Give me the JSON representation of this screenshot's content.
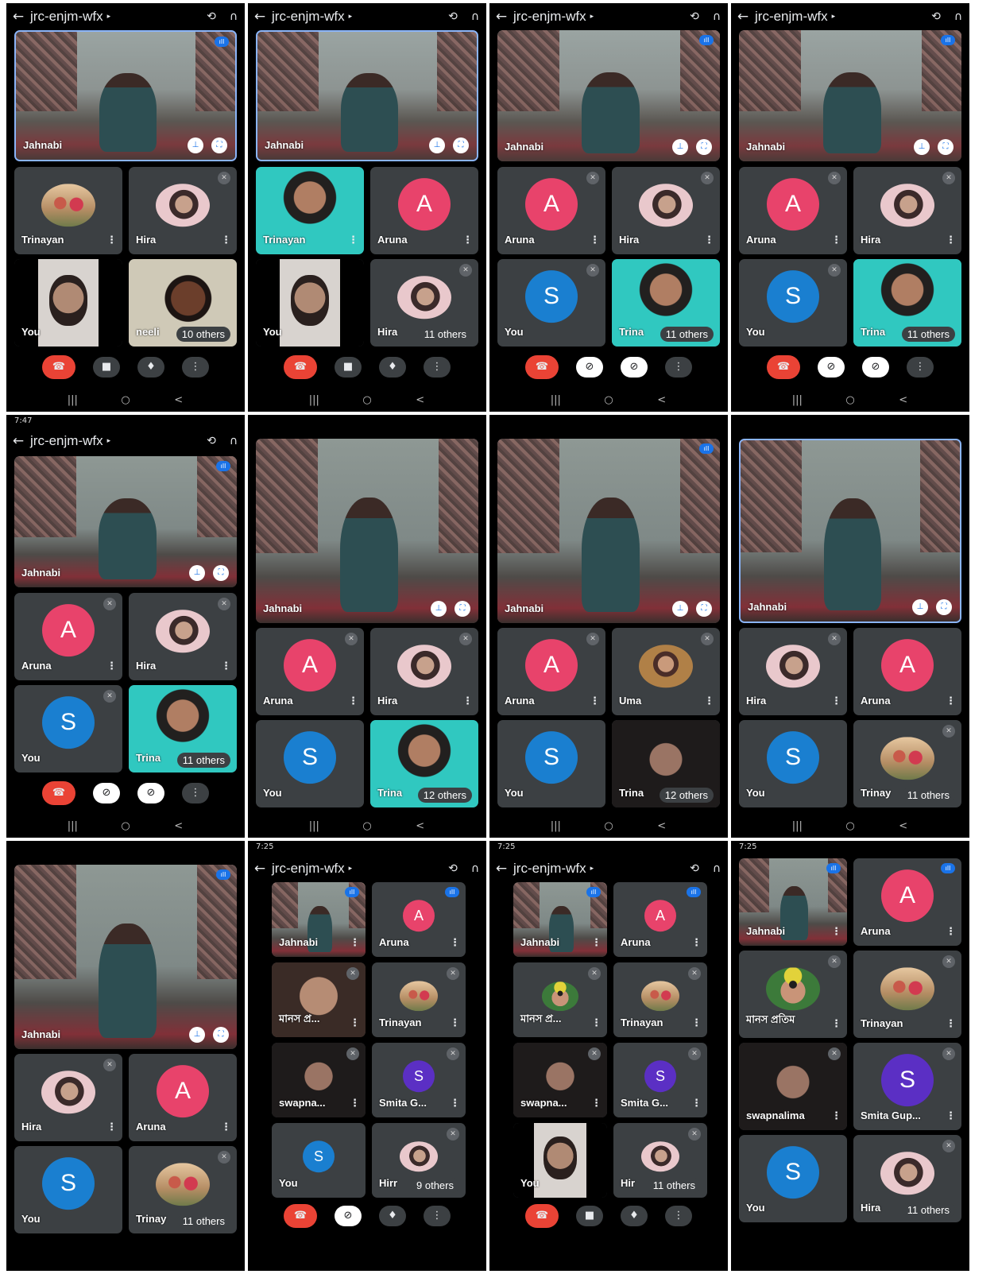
{
  "meeting_code": "jrc-enjm-wfx",
  "status_time_row2": "7:47",
  "status_time_row3": "7:25",
  "names": {
    "jahnabi": "Jahnabi",
    "trinayan": "Trinayan",
    "trinayan_cut": "Trina",
    "trinayan_cut2": "Trinay",
    "hira": "Hira",
    "hira_cut": "Hir",
    "hira_cut2": "Hirr",
    "aruna": "Aruna",
    "you": "You",
    "neeli": "neeli",
    "uma": "Uma",
    "manas_short": "মানস প্র...",
    "manas_full": "মানস প্রতিম",
    "swapna_short": "swapna...",
    "swapna_full": "swapnalima",
    "smita_short": "Smita G...",
    "smita_full": "Smita Gup..."
  },
  "others": {
    "nine": "9 others",
    "ten": "10 others",
    "eleven": "11 others",
    "twelve": "12 others"
  },
  "letters": {
    "aruna": "A",
    "you": "S",
    "smita": "S"
  },
  "colors": {
    "aruna": "#e8436b",
    "you": "#1a7fd0",
    "smita": "#5b2fc4",
    "end_call": "#ea4335",
    "highlight": "#8ab4f8",
    "speaking": "#1a73e8"
  },
  "icons": {
    "back": "←",
    "caret": "▸",
    "switch_camera": "⟲",
    "audio": "∩",
    "kebab": "⋮",
    "muted": "✕",
    "speaking": "ıll",
    "pin": "⊥",
    "fullscreen": "⛶",
    "end_call": "☎",
    "camera": "■",
    "camera_off": "⊘",
    "mic": "♦",
    "mic_off": "⊘",
    "more": "⋮",
    "nav_recent": "|||",
    "nav_home": "○",
    "nav_back": "<"
  }
}
